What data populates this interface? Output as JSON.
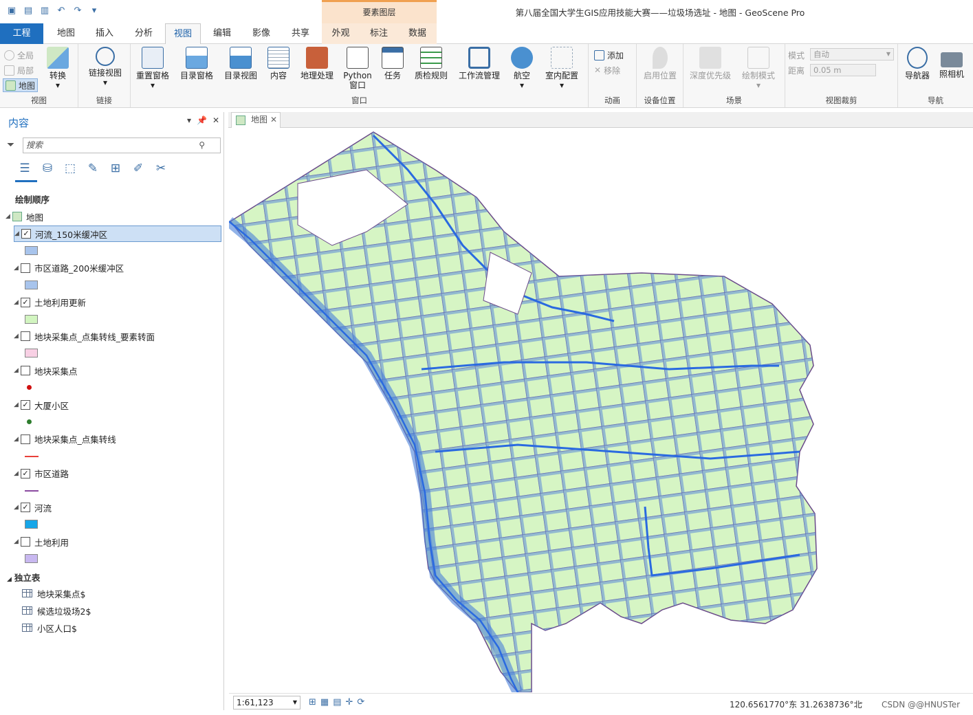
{
  "quick_access": [
    "new-project-icon",
    "open-project-icon",
    "save-project-icon",
    "undo-icon",
    "redo-icon",
    "customize-icon"
  ],
  "contextual_tab": "要素图层",
  "window_title": "第八届全国大学生GIS应用技能大赛——垃圾场选址 - 地图 - GeoScene Pro",
  "tabs": [
    "工程",
    "地图",
    "插入",
    "分析",
    "视图",
    "编辑",
    "影像",
    "共享",
    "外观",
    "标注",
    "数据"
  ],
  "active_tab": "视图",
  "ribbon": {
    "view_group": {
      "label": "视图",
      "full": "全局",
      "local": "局部",
      "map": "地图",
      "convert": "转换"
    },
    "link_group": {
      "label": "链接",
      "link_views": "链接视图"
    },
    "window_group": {
      "label": "窗口",
      "buttons": [
        "重置窗格",
        "目录窗格",
        "目录视图",
        "内容",
        "地理处理",
        "Python\n窗口",
        "任务",
        "质检规则",
        "工作流管理",
        "航空",
        "室内配置"
      ]
    },
    "animation_group": {
      "label": "动画",
      "add": "添加",
      "remove": "移除"
    },
    "device_group": {
      "label": "设备位置",
      "enable": "启用位置"
    },
    "scene_group": {
      "label": "场景",
      "depth": "深度优先级",
      "draw_mode": "绘制模式"
    },
    "clip_group": {
      "label": "视图裁剪",
      "mode_label": "模式",
      "mode_value": "自动",
      "distance_label": "距离",
      "distance_value": "0.05 m"
    },
    "nav_group": {
      "label": "导航",
      "navigator": "导航器",
      "camera": "照相机"
    }
  },
  "contents": {
    "title": "内容",
    "search_placeholder": "搜索",
    "drawing_order": "绘制顺序",
    "map_name": "地图",
    "layers": [
      {
        "name": "河流_150米缓冲区",
        "checked": "✓",
        "symbol": "#a8c4ec"
      },
      {
        "name": "市区道路_200米缓冲区",
        "checked": "",
        "symbol": "#a8c4ec"
      },
      {
        "name": "土地利用更新",
        "checked": "✓",
        "symbol": "#d2f5c0"
      },
      {
        "name": "地块采集点_点集转线_要素转面",
        "checked": "",
        "symbol": "#f8d0e4"
      },
      {
        "name": "地块采集点",
        "checked": "",
        "symbol": "#d01010"
      },
      {
        "name": "大厦小区",
        "checked": "✓",
        "symbol": "#2e7d2e"
      },
      {
        "name": "地块采集点_点集转线",
        "checked": "",
        "symbol": "#e8403a"
      },
      {
        "name": "市区道路",
        "checked": "✓",
        "symbol": "#8a4aa0"
      },
      {
        "name": "河流",
        "checked": "✓",
        "symbol": "#16a6e8"
      },
      {
        "name": "土地利用",
        "checked": "",
        "symbol": "#c8b8f0"
      }
    ],
    "standalone_title": "独立表",
    "tables": [
      "地块采集点$",
      "候选垃圾场2$",
      "小区人口$"
    ]
  },
  "map_tab": "地图",
  "status": {
    "scale": "1:61,123",
    "coordinates": "120.6561770°东 31.2638736°北",
    "watermark": "CSDN @@HNUSTer"
  }
}
